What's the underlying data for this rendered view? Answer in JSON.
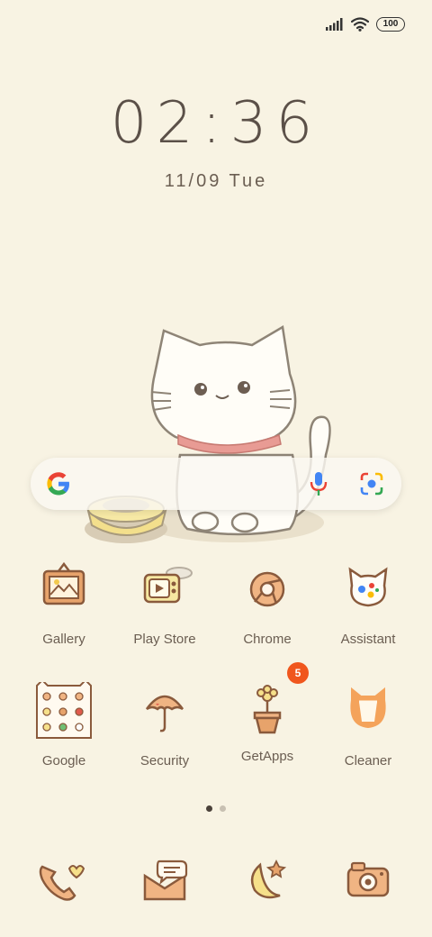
{
  "status": {
    "battery": "100"
  },
  "clock": {
    "time": "02:36",
    "date": "11/09 Tue"
  },
  "apps": [
    {
      "label": "Gallery"
    },
    {
      "label": "Play Store"
    },
    {
      "label": "Chrome"
    },
    {
      "label": "Assistant"
    },
    {
      "label": "Google"
    },
    {
      "label": "Security"
    },
    {
      "label": "GetApps",
      "badge": "5"
    },
    {
      "label": "Cleaner"
    }
  ],
  "colors": {
    "background": "#f8f3e3",
    "badge": "#f0561d",
    "icon_outline": "#8a5a3c",
    "icon_fill": "#f0b483"
  },
  "page_indicator": {
    "count": 2,
    "active": 1
  }
}
